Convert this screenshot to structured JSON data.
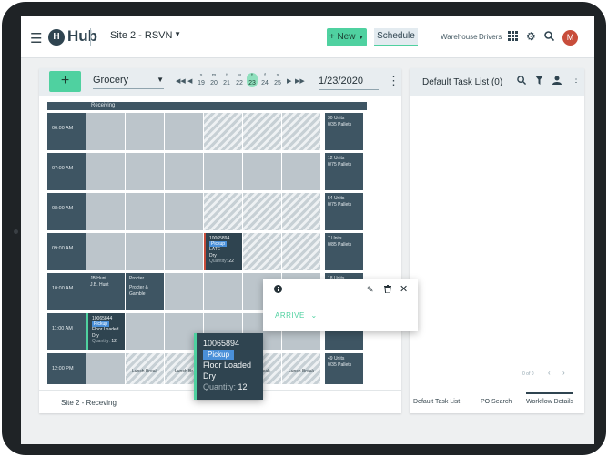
{
  "topbar": {
    "menu_icon": "menu-icon",
    "logo_glyph": "H",
    "brand": "Hub",
    "site": "Site 2 - RSVN",
    "new_label": "+ New",
    "schedule_label": "Schedule",
    "warehouse_label": "Warehouse",
    "drivers_label": "Drivers",
    "avatar_initial": "M",
    "colors": {
      "accent": "#4fd1a0",
      "dark": "#2f4450",
      "avatar": "#c84d3b"
    }
  },
  "schedule": {
    "add_label": "+",
    "category": "Grocery",
    "days": [
      {
        "letter": "s",
        "num": "19"
      },
      {
        "letter": "m",
        "num": "20"
      },
      {
        "letter": "t",
        "num": "21"
      },
      {
        "letter": "w",
        "num": "22"
      },
      {
        "letter": "t",
        "num": "23",
        "selected": true
      },
      {
        "letter": "f",
        "num": "24"
      },
      {
        "letter": "s",
        "num": "25"
      }
    ],
    "date": "1/23/2020",
    "door_label": "Receiving",
    "times": [
      "06:00 AM",
      "07:00 AM",
      "08:00 AM",
      "09:00 AM",
      "10:00 AM",
      "11:00 AM",
      "12:00 PM"
    ],
    "capacity": [
      {
        "units": "30 Units",
        "pallets": "0/35 Pallets"
      },
      {
        "units": "12 Units",
        "pallets": "0/75 Pallets"
      },
      {
        "units": "54 Units",
        "pallets": "0/75 Pallets"
      },
      {
        "units": "7 Units",
        "pallets": "0/85 Pallets"
      },
      {
        "units": "18 Units",
        "pallets": ""
      },
      {
        "units": "",
        "pallets": ""
      },
      {
        "units": "49 Units",
        "pallets": "0/35 Pallets"
      }
    ],
    "booked": [
      {
        "line1": "JB Hunt",
        "line2": "J.B. Hunt"
      },
      {
        "line1": "Procter",
        "line2": "Procter & Gamble"
      }
    ],
    "appt_late": {
      "id": "10065894",
      "badge": "Pickup",
      "status": "LATE",
      "type": "Dry",
      "qty_label": "Quantity:",
      "qty": "22"
    },
    "appt_ok": {
      "id": "10065844",
      "badge": "Pickup",
      "line1": "Floor Loaded",
      "line2": "Dry",
      "qty_label": "Quantity:",
      "qty": "12"
    },
    "lunch_label": "Lunch Break",
    "lunch_short": "Lunch Br",
    "lunch_partial": "h Break",
    "footer": "Site 2 - Receving"
  },
  "popover": {
    "arrive_label": "ARRIVE"
  },
  "tooltip": {
    "id": "10065894",
    "badge": "Pickup",
    "line1": "Floor Loaded",
    "line2": "Dry",
    "qty_label": "Quantity:",
    "qty": "12"
  },
  "tasks": {
    "title": "Default Task List (0)",
    "pager": "0 of 0",
    "tabs": [
      "Default Task List",
      "PO Search",
      "Workflow Details"
    ]
  }
}
